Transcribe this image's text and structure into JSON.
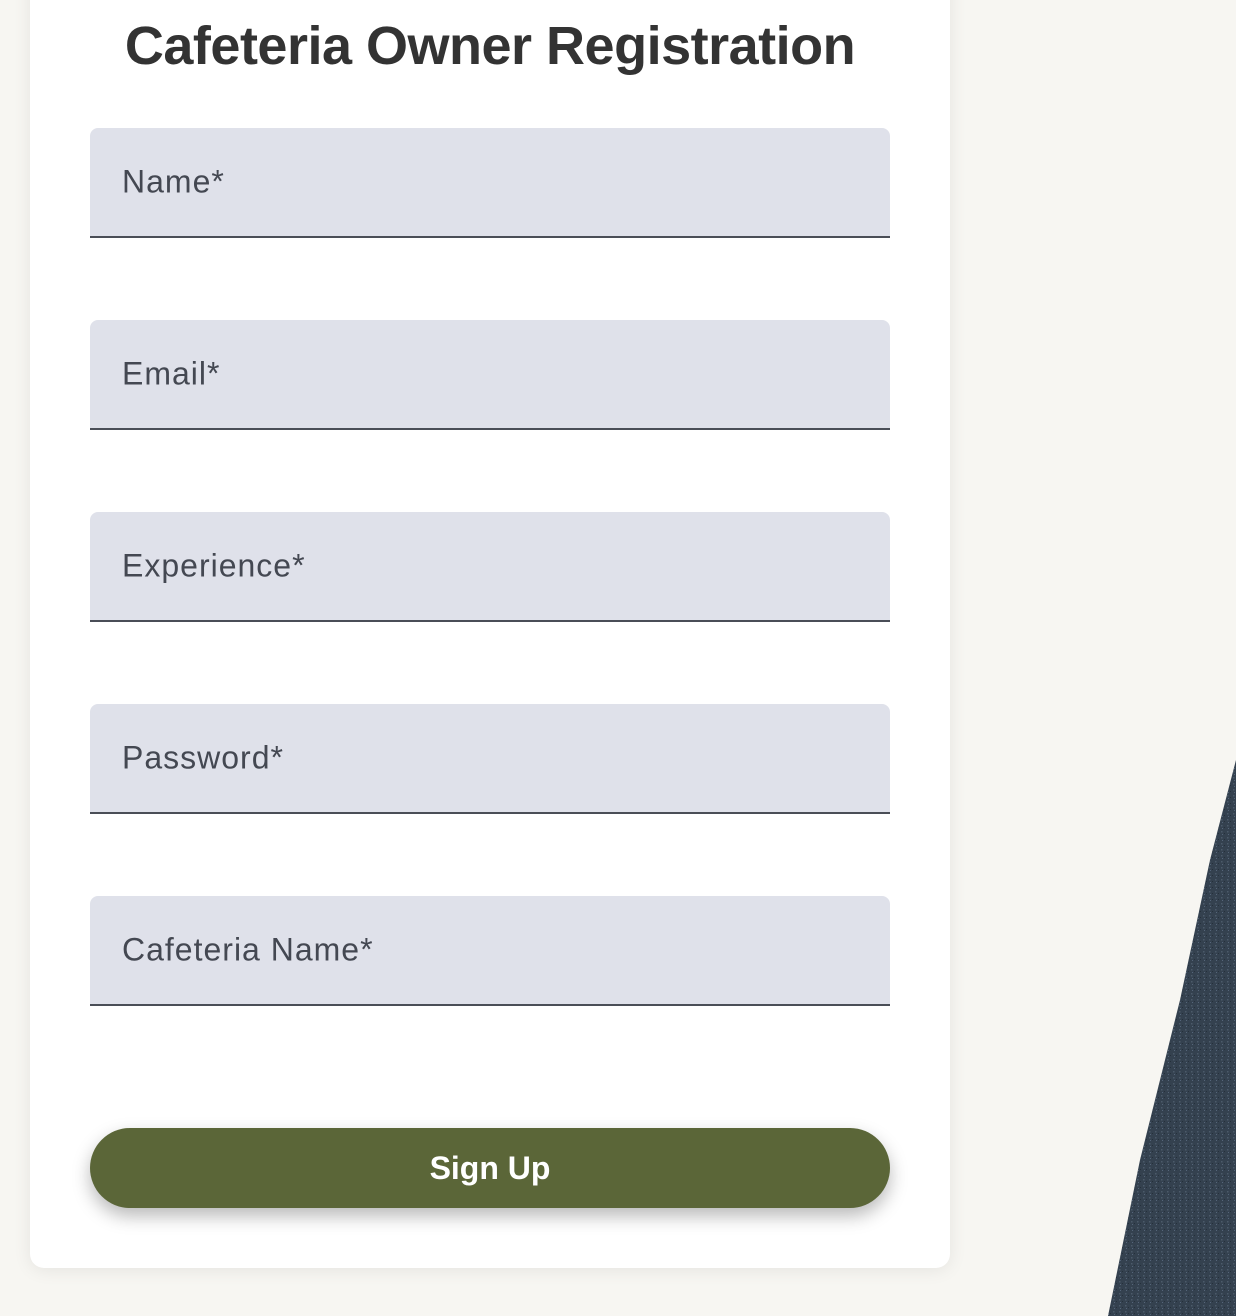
{
  "form": {
    "title": "Cafeteria Owner Registration",
    "fields": [
      {
        "label": "Name*",
        "value": ""
      },
      {
        "label": "Email*",
        "value": ""
      },
      {
        "label": "Experience*",
        "value": ""
      },
      {
        "label": "Password*",
        "value": ""
      },
      {
        "label": "Cafeteria Name*",
        "value": ""
      }
    ],
    "submit_label": "Sign Up"
  },
  "colors": {
    "page_background": "#f7f6f2",
    "card_background": "#ffffff",
    "field_background": "#dfe1ea",
    "button_background": "#5b6638",
    "button_text": "#ffffff",
    "title_text": "#333333"
  }
}
